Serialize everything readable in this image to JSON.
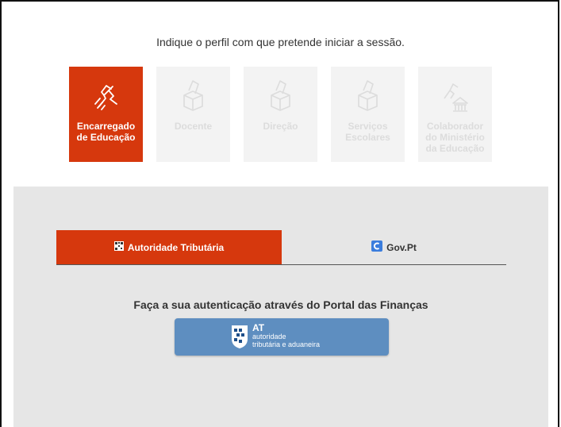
{
  "header": {
    "prompt": "Indique o perfil com que pretende iniciar a sessão."
  },
  "profiles": [
    {
      "label": "Encarregado de Educação",
      "icon": "hand-icon",
      "active": true
    },
    {
      "label": "Docente",
      "icon": "ballot-box-icon",
      "active": false
    },
    {
      "label": "Direção",
      "icon": "ballot-box-icon",
      "active": false
    },
    {
      "label": "Serviços Escolares",
      "icon": "ballot-box-icon",
      "active": false
    },
    {
      "label": "Colaborador do Ministério da Educação",
      "icon": "building-hand-icon",
      "active": false
    }
  ],
  "login": {
    "tabs": [
      {
        "label": "Autoridade Tributária",
        "active": true
      },
      {
        "label": "Gov.Pt",
        "active": false
      }
    ],
    "message": "Faça a sua autenticação através do Portal das Finanças",
    "at_button": {
      "title": "AT",
      "line1": "autoridade",
      "line2": "tributária e aduaneira"
    }
  },
  "colors": {
    "accent": "#d6380d",
    "panel_bg": "#e6e6e6",
    "at_button": "#5e8ec0",
    "inactive_card": "#f3f3f3"
  }
}
